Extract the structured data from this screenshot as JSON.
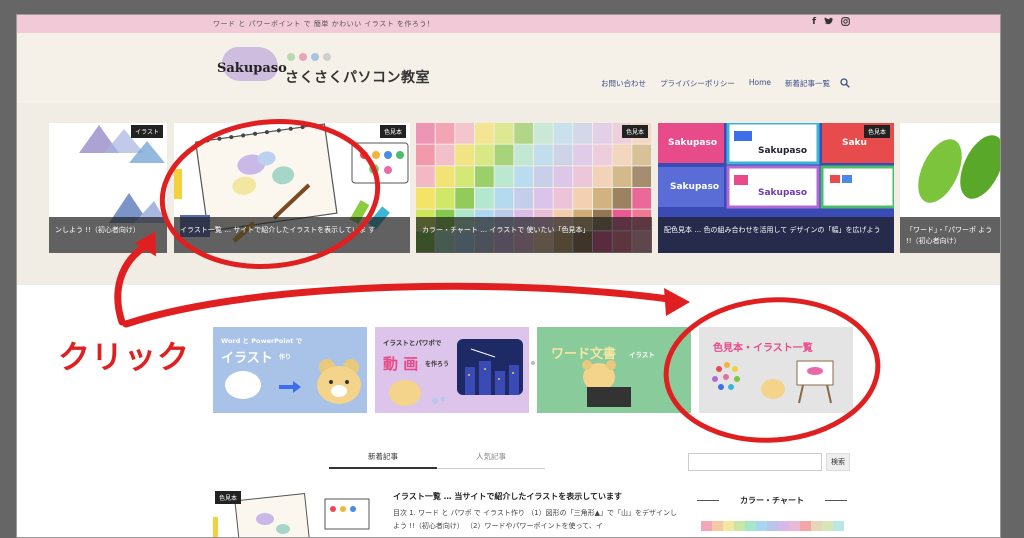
{
  "topbar": {
    "tagline": "ワード と パワーポイント で 簡単 かわいい イラスト を作ろう！",
    "social": [
      {
        "icon": "facebook-icon",
        "glyph": "f"
      },
      {
        "icon": "twitter-icon",
        "glyph": "🐦"
      },
      {
        "icon": "instagram-icon",
        "glyph": "◎"
      }
    ]
  },
  "header": {
    "logo_text": "Sakupaso",
    "site_title": "さくさくパソコン教室",
    "dot_colors": [
      "#b9d9b0",
      "#e6a6b8",
      "#a8c4e0",
      "#cfcfcf"
    ],
    "nav": [
      {
        "label": "お問い合わせ"
      },
      {
        "label": "プライバシーポリシー"
      },
      {
        "label": "Home"
      },
      {
        "label": "新着記事一覧"
      }
    ]
  },
  "slider": {
    "slides": [
      {
        "category": "イラスト",
        "caption": "ンしよう !!（初心者向け）"
      },
      {
        "category": "色見本",
        "caption": "イラスト一覧 … サイトで紹介したイラストを表示していま す"
      },
      {
        "category": "色見本",
        "caption": "カラー・チャート … イラストで 使いたい「色見本」"
      },
      {
        "category": "色見本",
        "caption": "配色見本 … 色の組み合わせを活用して デザインの「幅」を広げよう"
      },
      {
        "category": "",
        "caption": "「ワード」・「パワーポ よう !!（初心者向け）"
      }
    ],
    "active_dot": 1,
    "dot_count": 6
  },
  "cards": [
    {
      "title_small": "Word と PowerPoint で",
      "title_big": "イラスト",
      "title_tail": "作り"
    },
    {
      "title_small": "イラストとパワポで",
      "title_big": "動 画",
      "title_tail": "を作ろう"
    },
    {
      "title_big": "ワード文書",
      "title_tail": "イラスト"
    },
    {
      "title_big": "色見本・イラスト一覧"
    }
  ],
  "tabs": {
    "active": "新着記事",
    "inactive": "人気記事"
  },
  "search": {
    "button": "検索"
  },
  "post": {
    "category": "色見本",
    "title": "イラスト一覧 … 当サイトで紹介したイラストを表示しています",
    "excerpt": "目次 1. ワード と パワポ で イラスト作り （1）図形の「三角形▲」で「山」をデザインしよう !!（初心者向け） （2）ワードやパワーポイントを使って、イ"
  },
  "widget": {
    "title": "カラー・チャート"
  },
  "annotation": {
    "click_label": "クリック"
  },
  "colors": {
    "accent_red": "#e02020",
    "topbar_pink": "#f2c9d6",
    "header_beige": "#f5f0e8",
    "nav_blue": "#3a4f8a"
  }
}
